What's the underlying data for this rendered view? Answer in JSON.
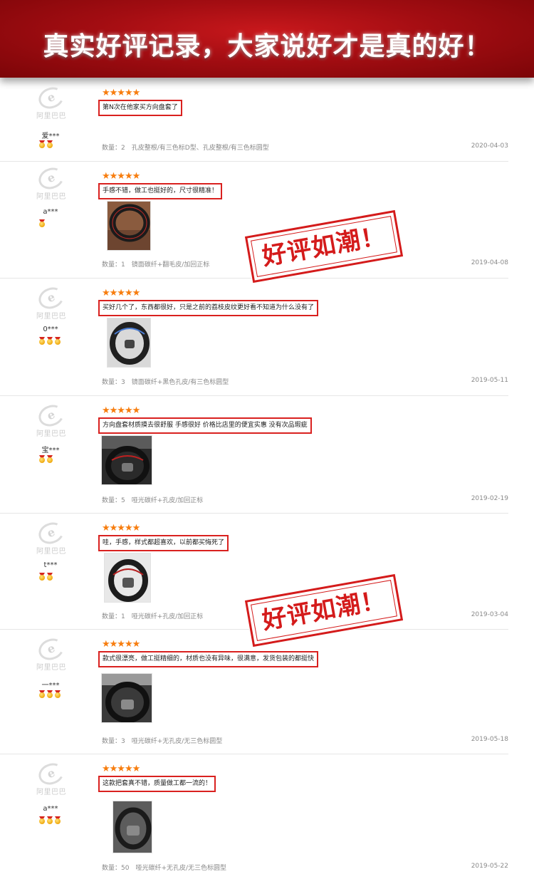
{
  "banner": {
    "title": "真实好评记录，大家说好才是真的好！"
  },
  "brand": {
    "logo_text": "阿里巴巴"
  },
  "rating_stars": "★★★★★",
  "stamp": {
    "text": "好评如潮！"
  },
  "colors": {
    "banner_red": "#a30d12",
    "highlight_red": "#d9211f",
    "star_orange": "#f77d0e"
  },
  "reviews": [
    {
      "user": "爱***",
      "medals": 2,
      "comment": "第N次在他家买方向盘套了",
      "meta": "数量：2　孔皮整根/有三色标D型、孔皮整根/有三色标圆型",
      "date": "2020-04-03",
      "has_photo": false
    },
    {
      "user": "a***",
      "medals": 1,
      "comment": "手感不错，做工也挺好的，尺寸很精准！",
      "meta": "数量：1　镜面碳纤+翻毛皮/加回正标",
      "date": "2019-04-08",
      "has_photo": true
    },
    {
      "user": "0***",
      "medals": 3,
      "comment": "买好几个了，东西都很好，只是之前的荔枝皮纹更好看不知道为什么没有了",
      "meta": "数量：3　镜面碳纤+黑色孔皮/有三色标圆型",
      "date": "2019-05-11",
      "has_photo": true
    },
    {
      "user": "宝***",
      "medals": 2,
      "comment": "方向盘套材质摸去很舒服 手感很好 价格比店里的便宜实惠 没有次品瑕疵",
      "meta": "数量：5　哑光碳纤+孔皮/加回正标",
      "date": "2019-02-19",
      "has_photo": true
    },
    {
      "user": "t***",
      "medals": 2,
      "comment": "哇，手感，样式都超喜欢，以前都买悔死了",
      "meta": "数量：1　哑光碳纤+孔皮/加回正标",
      "date": "2019-03-04",
      "has_photo": true
    },
    {
      "user": "一***",
      "medals": 3,
      "comment": "款式很漂亮，做工挺精细的，材质也没有异味，很满意，发货包装的都挺快",
      "meta": "数量：3　哑光碳纤+无孔皮/无三色标圆型",
      "date": "2019-05-18",
      "has_photo": true
    },
    {
      "user": "a***",
      "medals": 3,
      "comment": "这款把套真不错，质量做工都一流的！",
      "meta": "数量：50　哑光碳纤+无孔皮/无三色标圆型",
      "date": "2019-05-22",
      "has_photo": true
    }
  ]
}
